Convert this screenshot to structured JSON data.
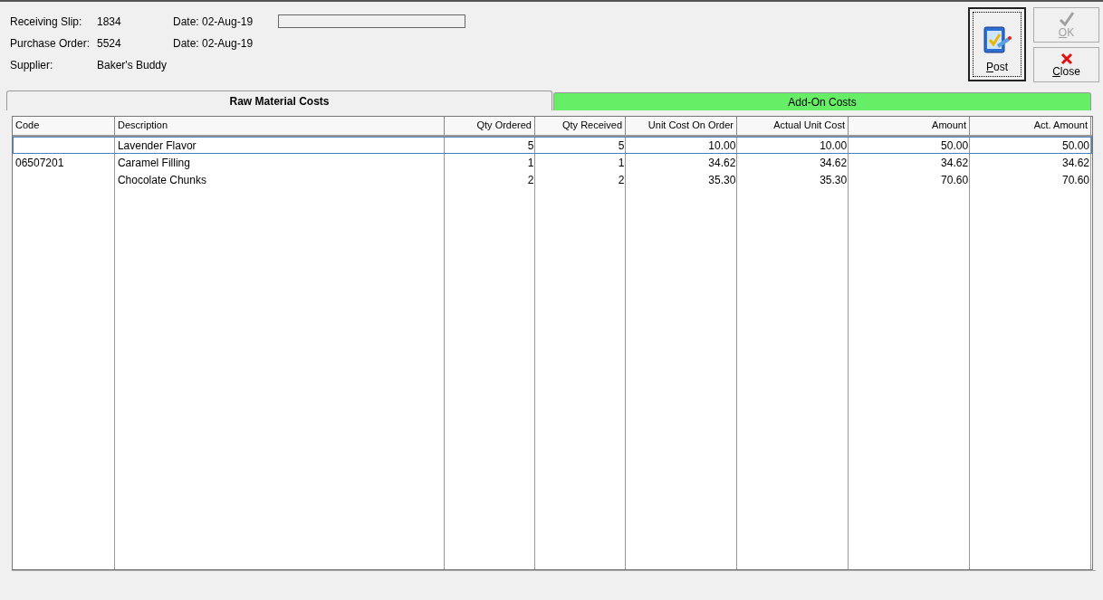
{
  "header": {
    "progress": {
      "level": 0
    },
    "fields": [
      {
        "label": "Receiving Slip:",
        "value": "1834",
        "date": "Date: 02-Aug-19"
      },
      {
        "label": "Purchase Order:",
        "value": "5524",
        "date": "Date: 02-Aug-19"
      },
      {
        "label": "Supplier:",
        "value": "Baker's Buddy"
      }
    ]
  },
  "buttons": [
    {
      "label": "Post",
      "kind": "post",
      "disabled": false
    },
    {
      "label": "OK",
      "kind": "ok",
      "disabled": true
    },
    {
      "label": "Close",
      "kind": "close",
      "disabled": false
    }
  ],
  "tabs": [
    {
      "label": "Raw Material Costs",
      "selected": true
    },
    {
      "label": "Add-On Costs",
      "selected": false,
      "color": "#66ee66"
    }
  ],
  "table": {
    "columns": [
      "Code",
      "Description",
      "Qty Ordered",
      "Qty Received",
      "Unit Cost On Order",
      "Actual Unit Cost",
      "Amount",
      "Act. Amount"
    ],
    "rows": [
      {
        "selected": true,
        "cells": [
          "",
          "Lavender Flavor",
          "5",
          "5",
          "10.00",
          "10.00",
          "50.00",
          "50.00"
        ]
      },
      {
        "selected": false,
        "cells": [
          "06507201",
          "Caramel Filling",
          "1",
          "1",
          "34.62",
          "34.62",
          "34.62",
          "34.62"
        ]
      },
      {
        "selected": false,
        "cells": [
          "",
          "Chocolate Chunks",
          "2",
          "2",
          "35.30",
          "35.30",
          "70.60",
          "70.60"
        ]
      }
    ]
  }
}
